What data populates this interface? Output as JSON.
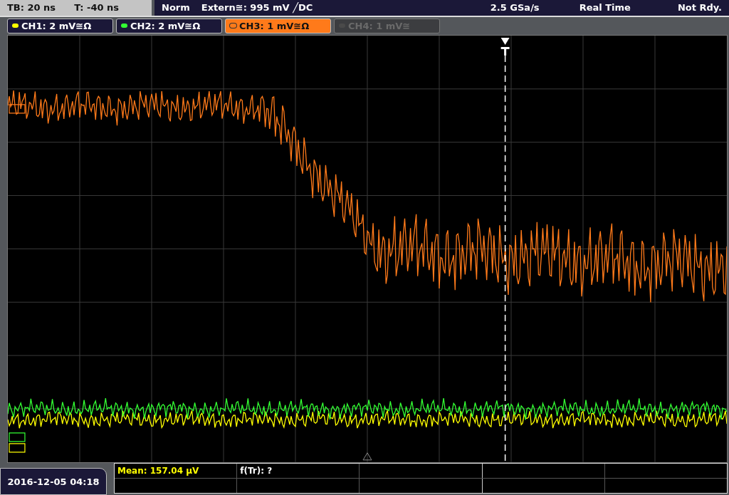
{
  "status_bar": {
    "timebase": "TB: 20 ns",
    "trigger_offset": "T: -40 ns",
    "trigger_mode": "Norm",
    "trigger_source": "Extern≅: 995 mV ╱DC",
    "sample_rate": "2.5 GSa/s",
    "acquisition": "Real Time",
    "state": "Not Rdy."
  },
  "channels": [
    {
      "label": "CH1: 2 mV≅Ω",
      "color": "#ffff00",
      "selected": false,
      "on": true
    },
    {
      "label": "CH2: 2 mV≅Ω",
      "color": "#33ff33",
      "selected": false,
      "on": true
    },
    {
      "label": "CH3: 1 mV≅Ω",
      "color": "#ff7a1a",
      "selected": true,
      "on": true
    },
    {
      "label": "CH4: 1 mV≅",
      "color": "#4a4a4a",
      "selected": false,
      "on": false
    }
  ],
  "timestamp": "2016-12-05 04:18",
  "measurements": [
    {
      "text": "Mean: 157.04 µV",
      "color": "#ffff00"
    },
    {
      "text": "f(Tr): ?",
      "color": "#ffffff"
    }
  ]
}
